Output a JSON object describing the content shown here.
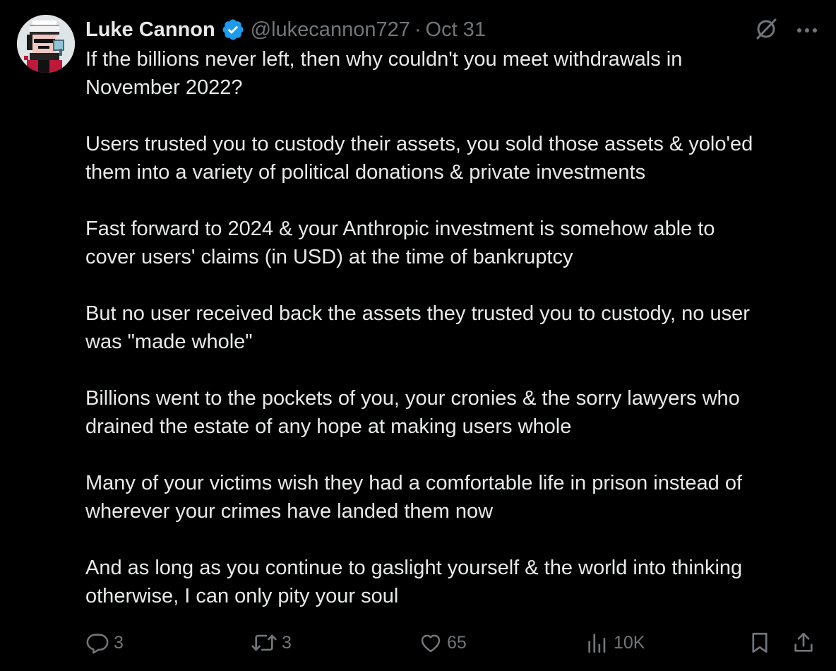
{
  "author": {
    "name": "Luke Cannon",
    "handle": "@lukecannon727",
    "separator": "·",
    "date": "Oct 31"
  },
  "icons": {
    "verified": "verified-badge-icon",
    "grok": "grok-icon",
    "more": "more-options-icon"
  },
  "body": {
    "paragraphs": [
      "If the billions never left, then why couldn't you meet withdrawals in\nNovember 2022?",
      "Users trusted you to custody their assets, you sold those assets & yolo'ed\nthem into a variety of political donations & private investments",
      "Fast forward to 2024 & your Anthropic investment is somehow able to\ncover users' claims (in USD) at the time of bankruptcy",
      "But no user received back the assets they trusted you to custody, no user\nwas \"made whole\"",
      "Billions went to the pockets of you, your cronies & the sorry lawyers who\ndrained the estate of any hope at making users whole",
      "Many of your victims wish they had a comfortable life in prison instead of\nwherever your crimes have landed them now",
      "And as long as you continue to gaslight yourself & the world into thinking\notherwise, I can only pity your soul"
    ]
  },
  "actions": {
    "replies": "3",
    "reposts": "3",
    "likes": "65",
    "views": "10K"
  },
  "colors": {
    "background": "#000000",
    "text": "#e7e9ea",
    "muted": "#71767b",
    "verified": "#1d9bf0"
  }
}
